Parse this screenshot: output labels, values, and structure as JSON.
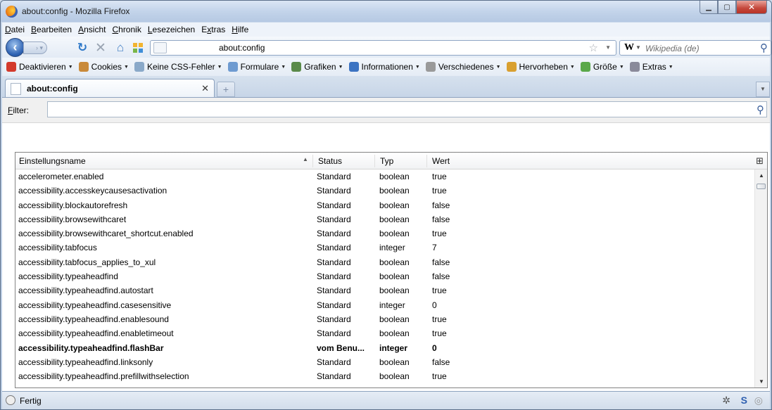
{
  "window": {
    "title": "about:config - Mozilla Firefox"
  },
  "menu": [
    "Datei",
    "Bearbeiten",
    "Ansicht",
    "Chronik",
    "Lesezeichen",
    "Extras",
    "Hilfe"
  ],
  "menu_access_keys": [
    "D",
    "B",
    "A",
    "C",
    "L",
    "x",
    "H"
  ],
  "navbar": {
    "url": "about:config",
    "search_engine": "W",
    "search_placeholder": "Wikipedia (de)"
  },
  "devbar": {
    "items": [
      {
        "label": "Deaktivieren",
        "icon": "no-entry-icon",
        "color": "#d33a2c"
      },
      {
        "label": "Cookies",
        "icon": "people-icon",
        "color": "#c98a3a"
      },
      {
        "label": "Keine CSS-Fehler",
        "icon": "css-icon",
        "color": "#8aa9c9"
      },
      {
        "label": "Formulare",
        "icon": "form-icon",
        "color": "#6e9bd1"
      },
      {
        "label": "Grafiken",
        "icon": "image-icon",
        "color": "#5a8a4a"
      },
      {
        "label": "Informationen",
        "icon": "info-icon",
        "color": "#3c73c2"
      },
      {
        "label": "Verschiedenes",
        "icon": "gear-icon",
        "color": "#9a9a9a"
      },
      {
        "label": "Hervorheben",
        "icon": "pencil-icon",
        "color": "#d9a030"
      },
      {
        "label": "Größe",
        "icon": "resize-icon",
        "color": "#5aa84a"
      },
      {
        "label": "Extras",
        "icon": "wrench-icon",
        "color": "#8a8a9a"
      }
    ]
  },
  "tabs": [
    {
      "label": "about:config"
    }
  ],
  "filter": {
    "label": "Filter:",
    "access_key": "F",
    "value": ""
  },
  "table": {
    "columns": [
      "Einstellungsname",
      "Status",
      "Typ",
      "Wert"
    ],
    "rows": [
      {
        "name": "accelerometer.enabled",
        "status": "Standard",
        "type": "boolean",
        "value": "true"
      },
      {
        "name": "accessibility.accesskeycausesactivation",
        "status": "Standard",
        "type": "boolean",
        "value": "true"
      },
      {
        "name": "accessibility.blockautorefresh",
        "status": "Standard",
        "type": "boolean",
        "value": "false"
      },
      {
        "name": "accessibility.browsewithcaret",
        "status": "Standard",
        "type": "boolean",
        "value": "false"
      },
      {
        "name": "accessibility.browsewithcaret_shortcut.enabled",
        "status": "Standard",
        "type": "boolean",
        "value": "true"
      },
      {
        "name": "accessibility.tabfocus",
        "status": "Standard",
        "type": "integer",
        "value": "7"
      },
      {
        "name": "accessibility.tabfocus_applies_to_xul",
        "status": "Standard",
        "type": "boolean",
        "value": "false"
      },
      {
        "name": "accessibility.typeaheadfind",
        "status": "Standard",
        "type": "boolean",
        "value": "false"
      },
      {
        "name": "accessibility.typeaheadfind.autostart",
        "status": "Standard",
        "type": "boolean",
        "value": "true"
      },
      {
        "name": "accessibility.typeaheadfind.casesensitive",
        "status": "Standard",
        "type": "integer",
        "value": "0"
      },
      {
        "name": "accessibility.typeaheadfind.enablesound",
        "status": "Standard",
        "type": "boolean",
        "value": "true"
      },
      {
        "name": "accessibility.typeaheadfind.enabletimeout",
        "status": "Standard",
        "type": "boolean",
        "value": "true"
      },
      {
        "name": "accessibility.typeaheadfind.flashBar",
        "status": "vom Benu...",
        "type": "integer",
        "value": "0",
        "modified": true
      },
      {
        "name": "accessibility.typeaheadfind.linksonly",
        "status": "Standard",
        "type": "boolean",
        "value": "false"
      },
      {
        "name": "accessibility.typeaheadfind.prefillwithselection",
        "status": "Standard",
        "type": "boolean",
        "value": "true"
      }
    ]
  },
  "status": {
    "text": "Fertig"
  }
}
